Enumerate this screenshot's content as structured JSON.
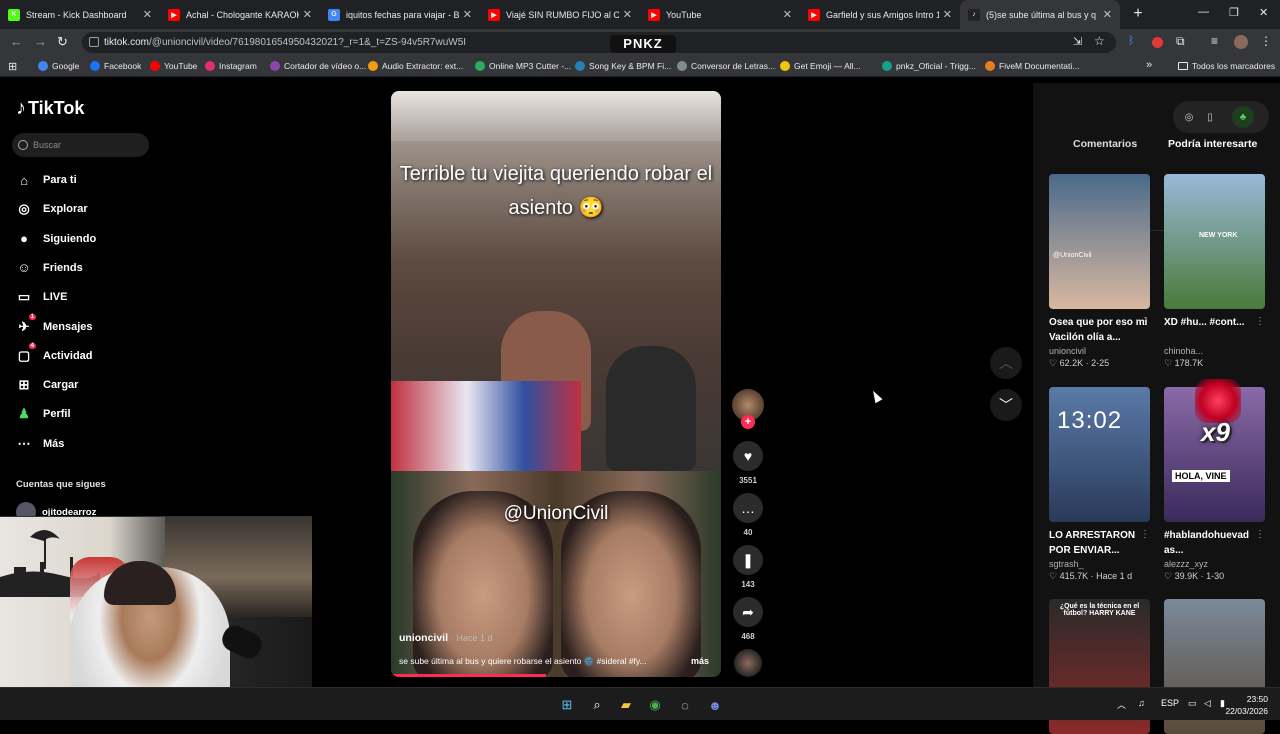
{
  "browser": {
    "tabs": [
      {
        "title": "Stream - Kick Dashboard",
        "fav_color": "#53fc18",
        "fav_glyph": "K"
      },
      {
        "title": "Achal - Chologante KARAOKE (",
        "fav_color": "#ff0000",
        "fav_glyph": "▶"
      },
      {
        "title": "iquitos fechas para viajar - Bus",
        "fav_color": "#4285f4",
        "fav_glyph": "G"
      },
      {
        "title": "Viajé SIN RUMBO FIJO al Cora",
        "fav_color": "#ff0000",
        "fav_glyph": "▶"
      },
      {
        "title": "YouTube",
        "fav_color": "#ff0000",
        "fav_glyph": "▶"
      },
      {
        "title": "Garfield y sus Amigos Intro 1 \"/",
        "fav_color": "#ff0000",
        "fav_glyph": "▶"
      },
      {
        "title": "(5)se sube última al bus y q",
        "fav_color": "#222222",
        "fav_glyph": "♪",
        "active": true
      }
    ],
    "url_host": "tiktok.com",
    "url_path": "/@unioncivil/video/7619801654950432021?_r=1&_t=ZS-94v5R7wuW5I",
    "overlay_label": "PNKZ",
    "bookmarks": [
      {
        "label": "Google",
        "color": "#4285f4"
      },
      {
        "label": "Facebook",
        "color": "#1877f2"
      },
      {
        "label": "YouTube",
        "color": "#ff0000"
      },
      {
        "label": "Instagram",
        "color": "#e1306c"
      },
      {
        "label": "Cortador de vídeo o...",
        "color": "#8e44ad"
      },
      {
        "label": "Audio Extractor: ext...",
        "color": "#f39c12"
      },
      {
        "label": "Online MP3 Cutter -...",
        "color": "#27ae60"
      },
      {
        "label": "Song Key & BPM Fi...",
        "color": "#2980b9"
      },
      {
        "label": "Conversor de Letras...",
        "color": "#7f8c8d"
      },
      {
        "label": "Get Emoji — All...",
        "color": "#f1c40f"
      },
      {
        "label": "pnkz_Oficial - Trigg...",
        "color": "#16a085"
      },
      {
        "label": "FiveM Documentati...",
        "color": "#e67e22"
      }
    ],
    "all_bookmarks": "Todos los marcadores"
  },
  "tiktok": {
    "logo": "TikTok",
    "search_placeholder": "Buscar",
    "nav": [
      {
        "label": "Para ti",
        "icon": "home-icon",
        "glyph": "⌂"
      },
      {
        "label": "Explorar",
        "icon": "compass-icon",
        "glyph": "◎"
      },
      {
        "label": "Siguiendo",
        "icon": "following-avatar-icon",
        "glyph": "●"
      },
      {
        "label": "Friends",
        "icon": "friends-icon",
        "glyph": "☺"
      },
      {
        "label": "LIVE",
        "icon": "live-icon",
        "glyph": "▭"
      },
      {
        "label": "Mensajes",
        "icon": "messages-icon",
        "glyph": "✈",
        "badge": "1"
      },
      {
        "label": "Actividad",
        "icon": "activity-icon",
        "glyph": "▢",
        "badge": "4"
      },
      {
        "label": "Cargar",
        "icon": "upload-icon",
        "glyph": "⊞"
      },
      {
        "label": "Perfil",
        "icon": "profile-icon",
        "glyph": "♟"
      },
      {
        "label": "Más",
        "icon": "more-icon",
        "glyph": "⋯"
      }
    ],
    "following_header": "Cuentas que sigues",
    "following_account": "ojitodearroz"
  },
  "video": {
    "caption": "Terrible tu viejita queriendo robar el asiento 😳",
    "watermark": "@UnionCivil",
    "author": "unioncivil",
    "time": "· Hace 1 d",
    "description": "se sube última al bus y quiere robarse el asiento 🌚 #sideral #fy...",
    "more": "más",
    "progress": 0.47,
    "likes": "3551",
    "comments": "40",
    "saves": "143",
    "shares": "468"
  },
  "panel": {
    "tab_comments": "Comentarios",
    "tab_suggested": "Podría interesarte",
    "cards": [
      {
        "title": "Osea que por eso mi Vacilón olía a...",
        "author": "unioncivil",
        "stats": "♡ 62.2K · 2-25",
        "thumb_text": "@UnionCivil",
        "c1": "#4a6a8a",
        "c2": "#d8b8a0"
      },
      {
        "title": "XD #hu... #cont...",
        "author": "chinoha...",
        "stats": "♡ 178.7K",
        "thumb_text": "NEW YORK",
        "c1": "#9ab8d8",
        "c2": "#4a7a3a"
      },
      {
        "title": "LO ARRESTARON POR ENVIAR...",
        "author": "sgtrash_",
        "stats": "♡ 415.7K · Hace 1 d",
        "thumb_text": "13:02",
        "c1": "#5a7aa8",
        "c2": "#2a3a5a"
      },
      {
        "title": "#hablandohuevad as...",
        "author": "alezzz_xyz",
        "stats": "♡ 39.9K · 1-30",
        "thumb_text": "HOLA, VINE",
        "c1": "#8a6aa8",
        "c2": "#3a2a5a"
      },
      {
        "title": "",
        "author": "",
        "stats": "",
        "thumb_text": "¿Qué es la técnica en el fútbol? HARRY KANE",
        "c1": "#2a2a2a",
        "c2": "#8a2a2a"
      },
      {
        "title": "",
        "author": "",
        "stats": "",
        "thumb_text": "",
        "c1": "#7a8a9a",
        "c2": "#5a4a3a"
      }
    ],
    "overlay_counter": "x9"
  },
  "taskbar": {
    "time": "23:50",
    "date": "22/03/2026",
    "lang": "ESP"
  }
}
